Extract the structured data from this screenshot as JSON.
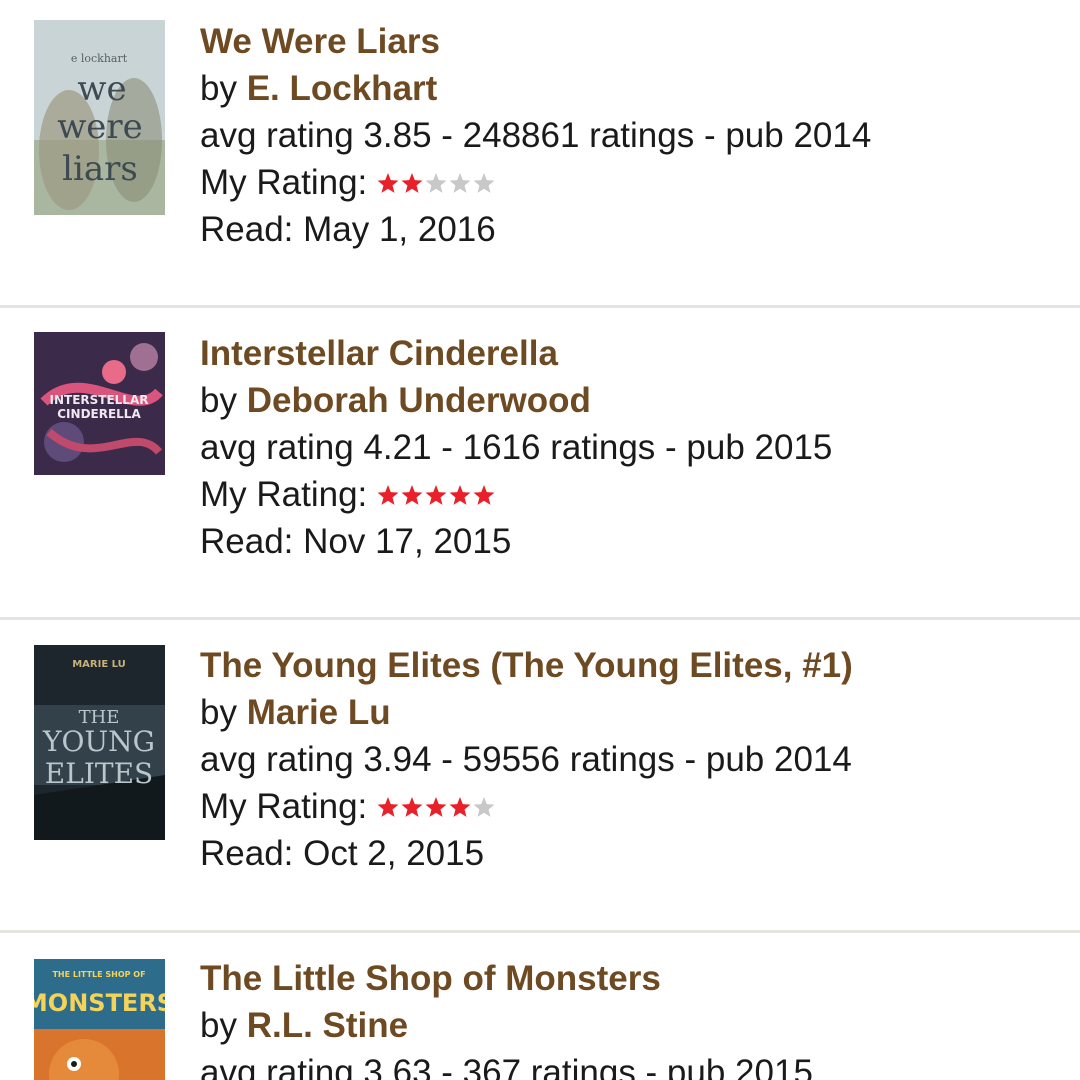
{
  "books": [
    {
      "title": "We Were Liars",
      "by_label": "by",
      "author": "E. Lockhart",
      "stats": "avg rating 3.85 - 248861 ratings - pub 2014",
      "my_rating_label": "My Rating:",
      "my_rating": 2,
      "max_rating": 5,
      "read": "Read: May 1, 2016",
      "cover_text": [
        "e lockhart",
        "we",
        "were",
        "liars"
      ]
    },
    {
      "title": "Interstellar Cinderella",
      "by_label": "by",
      "author": "Deborah Underwood",
      "stats": "avg rating 4.21 - 1616 ratings - pub 2015",
      "my_rating_label": "My Rating:",
      "my_rating": 5,
      "max_rating": 5,
      "read": "Read: Nov 17, 2015",
      "cover_text": [
        "INTERSTELLAR",
        "CINDERELLA"
      ]
    },
    {
      "title": "The Young Elites (The Young Elites, #1)",
      "by_label": "by",
      "author": "Marie Lu",
      "stats": "avg rating 3.94 - 59556 ratings - pub 2014",
      "my_rating_label": "My Rating:",
      "my_rating": 4,
      "max_rating": 5,
      "read": "Read: Oct 2, 2015",
      "cover_text": [
        "MARIE LU",
        "THE",
        "YOUNG",
        "ELITES"
      ]
    },
    {
      "title": "The Little Shop of Monsters",
      "by_label": "by",
      "author": "R.L. Stine",
      "stats": "avg rating 3.63 - 367 ratings - pub 2015",
      "cover_text": [
        "THE LITTLE SHOP OF",
        "MONSTERS"
      ]
    }
  ],
  "colors": {
    "link": "#6e4a22",
    "star_on": "#e8202a",
    "star_off": "#c8c8c8",
    "divider": "#e6e4e0"
  }
}
